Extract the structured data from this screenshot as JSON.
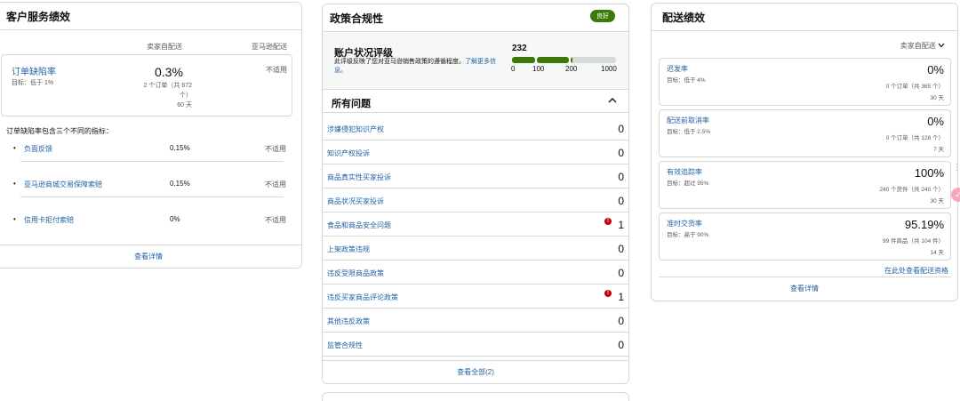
{
  "customer_service": {
    "title": "客户服务绩效",
    "col_seller": "卖家自配送",
    "col_amazon": "亚马逊配送",
    "odr": {
      "title": "订单缺陷率",
      "target": "目标：低于 1%",
      "value": "0.3%",
      "sub": "2 个订单（共 672 个）",
      "days": "60 天",
      "amazon": "不适用"
    },
    "desc": "订单缺陷率包含三个不同的指标：",
    "sub_metrics": [
      {
        "label": "负面反馈",
        "value": "0.15%",
        "amazon": "不适用"
      },
      {
        "label": "亚马逊商城交易保障索赔",
        "value": "0.15%",
        "amazon": "不适用"
      },
      {
        "label": "信用卡拒付索赔",
        "value": "0%",
        "amazon": "不适用"
      }
    ],
    "footer": "查看详情"
  },
  "policy": {
    "title": "政策合规性",
    "badge": "良好",
    "account_health": {
      "title": "账户状况评级",
      "desc": "此评级反映了您对亚马逊销售政策的遵循程度。",
      "link": "了解更多信息。",
      "score": "232",
      "score_fraction": 0.232,
      "ticks": [
        "0",
        "100",
        "200",
        "1000"
      ]
    },
    "issues_title": "所有问题",
    "issues": [
      {
        "label": "涉嫌侵犯知识产权",
        "count": "0",
        "alert": false
      },
      {
        "label": "知识产权投诉",
        "count": "0",
        "alert": false
      },
      {
        "label": "商品真实性买家投诉",
        "count": "0",
        "alert": false
      },
      {
        "label": "商品状况买家投诉",
        "count": "0",
        "alert": false
      },
      {
        "label": "食品和商品安全问题",
        "count": "1",
        "alert": true
      },
      {
        "label": "上架政策违规",
        "count": "0",
        "alert": false
      },
      {
        "label": "违反受限商品政策",
        "count": "0",
        "alert": false
      },
      {
        "label": "违反买家商品评论政策",
        "count": "1",
        "alert": true
      },
      {
        "label": "其他违反政策",
        "count": "0",
        "alert": false
      },
      {
        "label": "监管合规性",
        "count": "0",
        "alert": false
      }
    ],
    "alert_icon": "!",
    "footer": "查看全部(2)"
  },
  "shipping": {
    "title": "配送绩效",
    "fulfilment": "卖家自配送",
    "metrics": [
      {
        "title": "迟发率",
        "target": "目标：低于 4%",
        "value": "0%",
        "sub": "0 个订单（共 365 个）",
        "days": "30 天"
      },
      {
        "title": "配送前取消率",
        "target": "目标：低于 2.5%",
        "value": "0%",
        "sub": "0 个订单（共 128 个）",
        "days": "7 天"
      },
      {
        "title": "有效追踪率",
        "target": "目标：超过 95%",
        "value": "100%",
        "sub": "240 个货件（共 240 个）",
        "days": "30 天"
      },
      {
        "title": "准时交货率",
        "target": "目标：高于 90%",
        "value": "95.19%",
        "sub": "99 件商品（共 104 件）",
        "days": "14 天"
      }
    ],
    "eligibility_link": "在此处查看配送资格",
    "footer": "查看详情"
  },
  "colors": {
    "good": "#3b7a08",
    "link": "#2162a1",
    "alert": "#c40000",
    "border": "#d5d9d9"
  },
  "icons": {
    "chevron_up": "^",
    "chevron_down": "⌄",
    "bullet": "•"
  }
}
